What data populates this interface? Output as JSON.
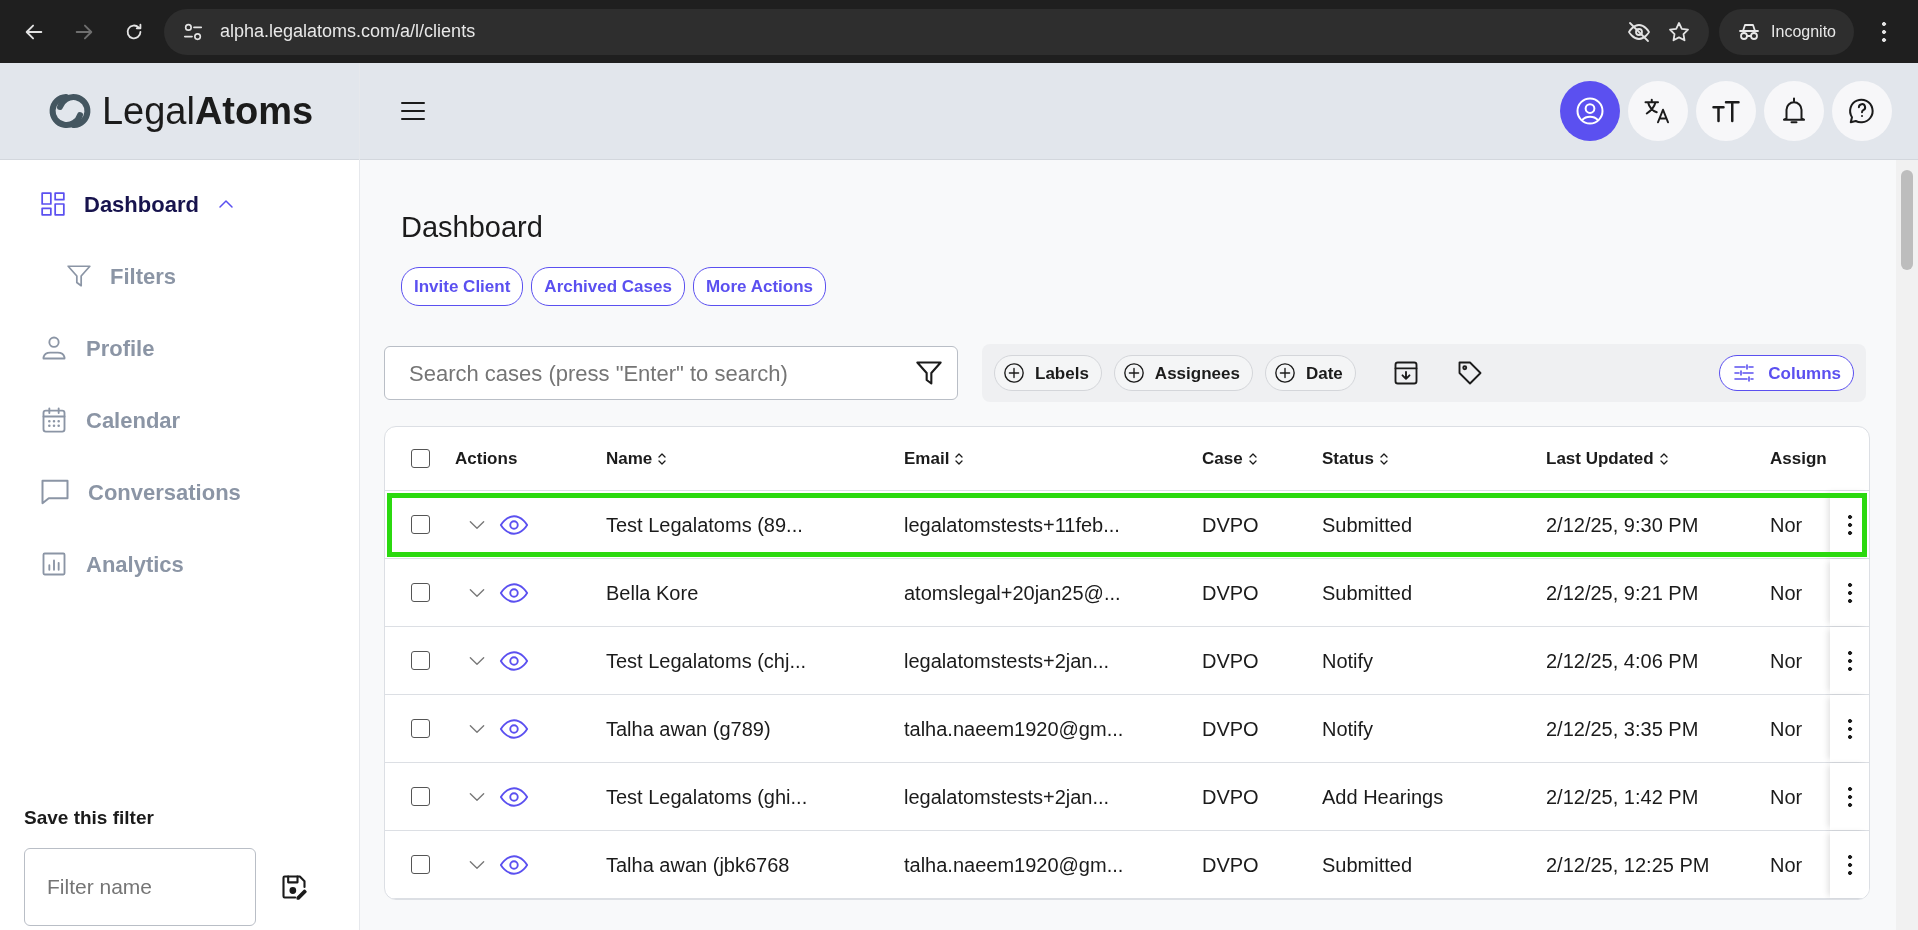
{
  "browser": {
    "nav": [
      {
        "kind": "back",
        "disabled": false
      },
      {
        "kind": "forward",
        "disabled": true
      },
      {
        "kind": "reload",
        "disabled": false
      }
    ],
    "url": "alpha.legalatoms.com/a/l/clients",
    "profile": "Incognito"
  },
  "logo": "Legal**Atoms**",
  "header_buttons": [
    {
      "kind": "profile",
      "active": true
    },
    {
      "kind": "translate",
      "active": false
    },
    {
      "kind": "text-size",
      "active": false
    },
    {
      "kind": "bell",
      "active": false
    },
    {
      "kind": "help",
      "active": false
    }
  ],
  "sidebar": {
    "items": [
      {
        "label": "Dashboard",
        "selected": true,
        "expanded": true,
        "children": [
          {
            "label": "Filters",
            "selected": false
          }
        ]
      },
      {
        "label": "Profile",
        "selected": false
      },
      {
        "label": "Calendar",
        "selected": false
      },
      {
        "label": "Conversations",
        "selected": false
      },
      {
        "label": "Analytics",
        "selected": false
      }
    ],
    "save_filter": {
      "title": "Save this filter",
      "placeholder": "Filter name"
    }
  },
  "page_title": "Dashboard",
  "actions": [
    "Invite Client",
    "Archived Cases",
    "More Actions"
  ],
  "search": {
    "placeholder": "Search cases (press \"Enter\" to search)"
  },
  "filter_chips": [
    "Labels",
    "Assignees",
    "Date"
  ],
  "columns_button": "Columns",
  "table": {
    "columns": [
      {
        "label": "Actions",
        "sortable": false
      },
      {
        "label": "Name",
        "sortable": true
      },
      {
        "label": "Email",
        "sortable": true
      },
      {
        "label": "Case",
        "sortable": true
      },
      {
        "label": "Status",
        "sortable": true
      },
      {
        "label": "Last Updated",
        "sortable": true
      },
      {
        "label": "Assign"
      }
    ],
    "all_checked": false,
    "rows": [
      {
        "checked": false,
        "highlighted": true,
        "cells": [
          "",
          "Test Legalatoms (89...",
          "legalatomstests+11feb...",
          "DVPO",
          "Submitted",
          "2/12/25, 9:30 PM",
          "Nor"
        ]
      },
      {
        "checked": false,
        "highlighted": false,
        "cells": [
          "",
          "Bella Kore",
          "atomslegal+20jan25@...",
          "DVPO",
          "Submitted",
          "2/12/25, 9:21 PM",
          "Nor"
        ]
      },
      {
        "checked": false,
        "highlighted": false,
        "cells": [
          "",
          "Test Legalatoms (chj...",
          "legalatomstests+2jan...",
          "DVPO",
          "Notify",
          "2/12/25, 4:06 PM",
          "Nor"
        ]
      },
      {
        "checked": false,
        "highlighted": false,
        "cells": [
          "",
          "Talha awan (g789)",
          "talha.naeem1920@gm...",
          "DVPO",
          "Notify",
          "2/12/25, 3:35 PM",
          "Nor"
        ]
      },
      {
        "checked": false,
        "highlighted": false,
        "cells": [
          "",
          "Test Legalatoms (ghi...",
          "legalatomstests+2jan...",
          "DVPO",
          "Add Hearings",
          "2/12/25, 1:42 PM",
          "Nor"
        ]
      },
      {
        "checked": false,
        "highlighted": false,
        "cells": [
          "",
          "Talha awan (jbk6768",
          "talha.naeem1920@gm...",
          "DVPO",
          "Submitted",
          "2/12/25, 12:25 PM",
          "Nor"
        ]
      }
    ]
  }
}
